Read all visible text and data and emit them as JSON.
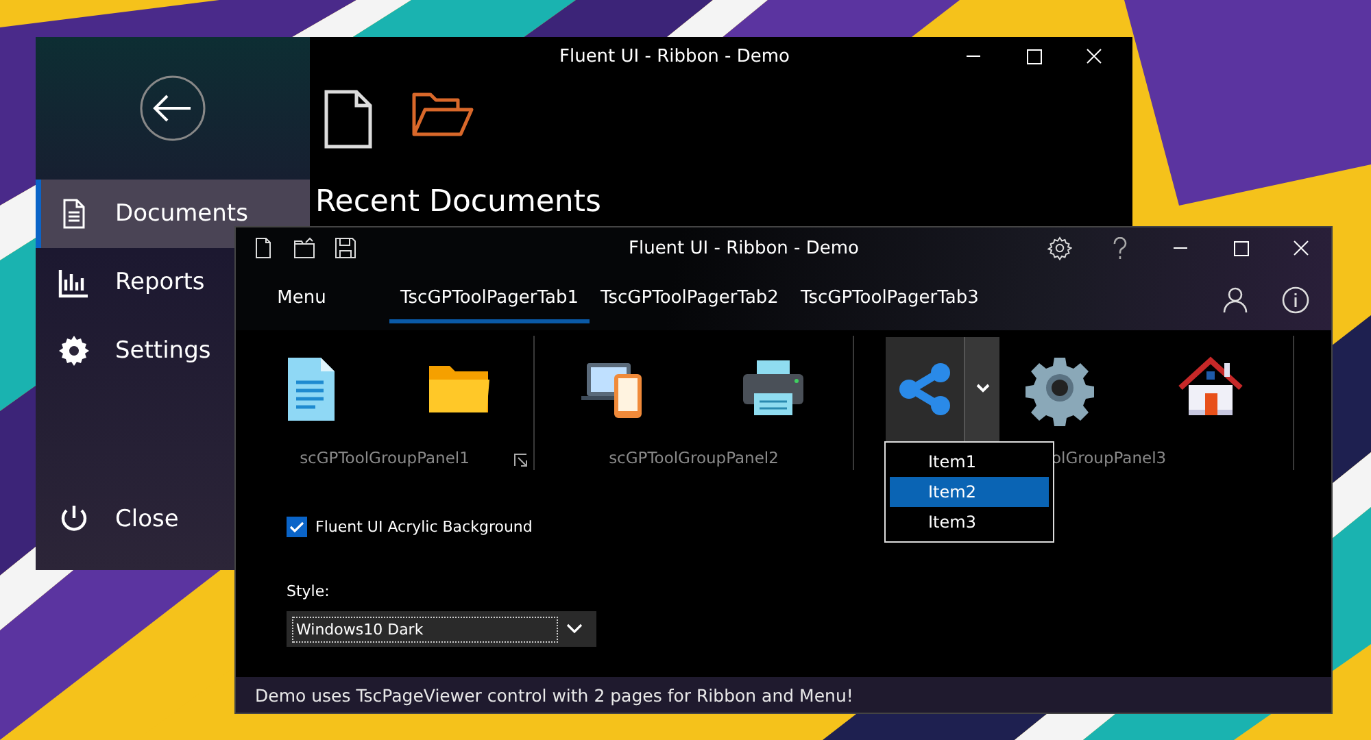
{
  "back_window": {
    "title": "Fluent UI - Ribbon - Demo",
    "sidebar": {
      "items": [
        {
          "label": "Documents",
          "selected": true
        },
        {
          "label": "Reports",
          "selected": false
        },
        {
          "label": "Settings",
          "selected": false
        }
      ],
      "footer_item": {
        "label": "Close"
      }
    },
    "heading": "Recent Documents"
  },
  "front_window": {
    "title": "Fluent UI - Ribbon - Demo",
    "tabs": [
      {
        "label": "Menu",
        "selected": false
      },
      {
        "label": "TscGPToolPagerTab1",
        "selected": true
      },
      {
        "label": "TscGPToolPagerTab2",
        "selected": false
      },
      {
        "label": "TscGPToolPagerTab3",
        "selected": false
      }
    ],
    "ribbon_groups": [
      {
        "label": "scGPToolGroupPanel1"
      },
      {
        "label": "scGPToolGroupPanel2"
      },
      {
        "label": "olGroupPanel3"
      }
    ],
    "dropdown_menu": [
      {
        "label": "Item1",
        "selected": false
      },
      {
        "label": "Item2",
        "selected": true
      },
      {
        "label": "Item3",
        "selected": false
      }
    ],
    "checkbox": {
      "label": "Fluent UI Acrylic Background",
      "checked": true
    },
    "style": {
      "label": "Style:",
      "value": "Windows10 Dark"
    },
    "status_bar": "Demo uses TscPageViewer control with 2 pages for Ribbon and Menu!"
  }
}
